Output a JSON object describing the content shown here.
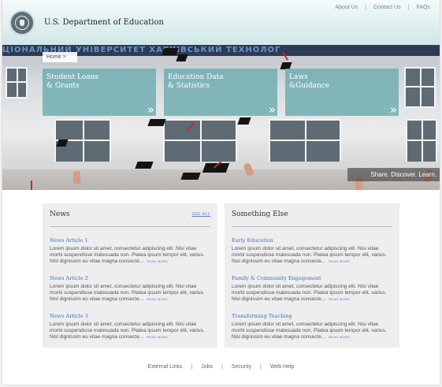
{
  "header": {
    "title": "U.S. Department of Education",
    "nav": [
      "About Us",
      "Contact Us",
      "FAQs"
    ]
  },
  "hero": {
    "building_text": "ЦІОНАЛЬНИЙ УНІВЕРСИТЕТ ХАРКІВСЬКИЙ ТЕХНОЛОГ",
    "breadcrumb": "Home >",
    "tiles": [
      {
        "line1": "Student Loans",
        "line2": "& Grants",
        "arrow": "»"
      },
      {
        "line1": "Education Data",
        "line2": "& Statistics",
        "arrow": "»"
      },
      {
        "line1": "Laws",
        "line2": "&Guidance",
        "arrow": "»"
      }
    ],
    "tagline": "Share. Discover. Learn."
  },
  "news": {
    "title": "News",
    "see_all": "SEE ALL",
    "items": [
      {
        "title": "News Article 1",
        "body": "Lorem ipsum dolor sit amet, consectetur adipiscing elit. Nisi vitae morbi suspendisse malesuada non. Platea ipsum tempor elit, varius. Nisl dignissim eu vitae magna consecte...",
        "more": "READ MORE"
      },
      {
        "title": "News Article 2",
        "body": "Lorem ipsum dolor sit amet, consectetur adipiscing elit. Nisi vitae morbi suspendisse malesuada non. Platea ipsum tempor elit, varius. Nisl dignissim eu vitae magna consecte...",
        "more": "READ MORE"
      },
      {
        "title": "News Article 3",
        "body": "Lorem ipsum dolor sit amet, consectetur adipiscing elit. Nisi vitae morbi suspendisse malesuada non. Platea ipsum tempor elit, varius. Nisl dignissim eu vitae magna consecte...",
        "more": "READ MORE"
      }
    ]
  },
  "other": {
    "title": "Something Else",
    "items": [
      {
        "title": "Early Education",
        "body": "Lorem ipsum dolor sit amet, consectetur adipiscing elit. Nisi vitae morbi suspendisse malesuada non. Platea ipsum tempor elit, varius. Nisl dignissim eu vitae magna consecte...",
        "more": "READ MORE"
      },
      {
        "title": "Family & Community Engagement",
        "body": "Lorem ipsum dolor sit amet, consectetur adipiscing elit. Nisi vitae morbi suspendisse malesuada non. Platea ipsum tempor elit, varius. Nisl dignissim eu vitae magna consecte...",
        "more": "READ MORE"
      },
      {
        "title": "Transforming Teaching",
        "body": "Lorem ipsum dolor sit amet, consectetur adipiscing elit. Nisi vitae morbi suspendisse malesuada non. Platea ipsum tempor elit, varius. Nisl dignissim eu vitae magna consecte...",
        "more": "READ MORE"
      }
    ]
  },
  "footer": {
    "links": [
      "External Links",
      "Jobs",
      "Security",
      "Web Help"
    ]
  },
  "colors": {
    "tile": "#6cacb0",
    "link": "#3f6fc9",
    "header_top": "#f4fafa",
    "header_bottom": "#cfe7e9"
  }
}
